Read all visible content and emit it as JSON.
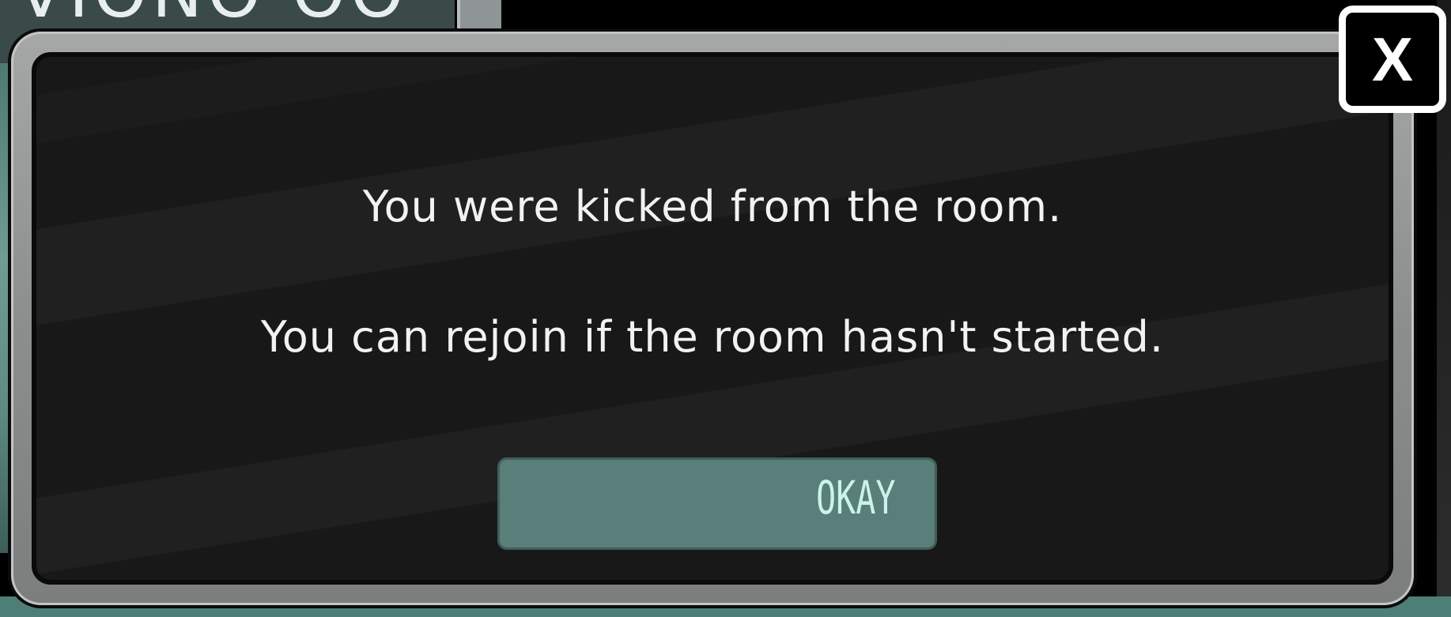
{
  "background": {
    "partial_text": "VIONO   OO"
  },
  "dialog": {
    "message_line_1": "You were kicked from the room.",
    "message_line_2": "You can rejoin if the room hasn't started.",
    "okay_label": "OKAY",
    "close_label": "X"
  },
  "colors": {
    "panel_background": "#181818",
    "frame": "#8d8f8f",
    "okay_button": "#5a7e79",
    "okay_text": "#c9f3eb",
    "message_text": "#f2f2f2"
  },
  "icons": {
    "close": "close-icon"
  }
}
